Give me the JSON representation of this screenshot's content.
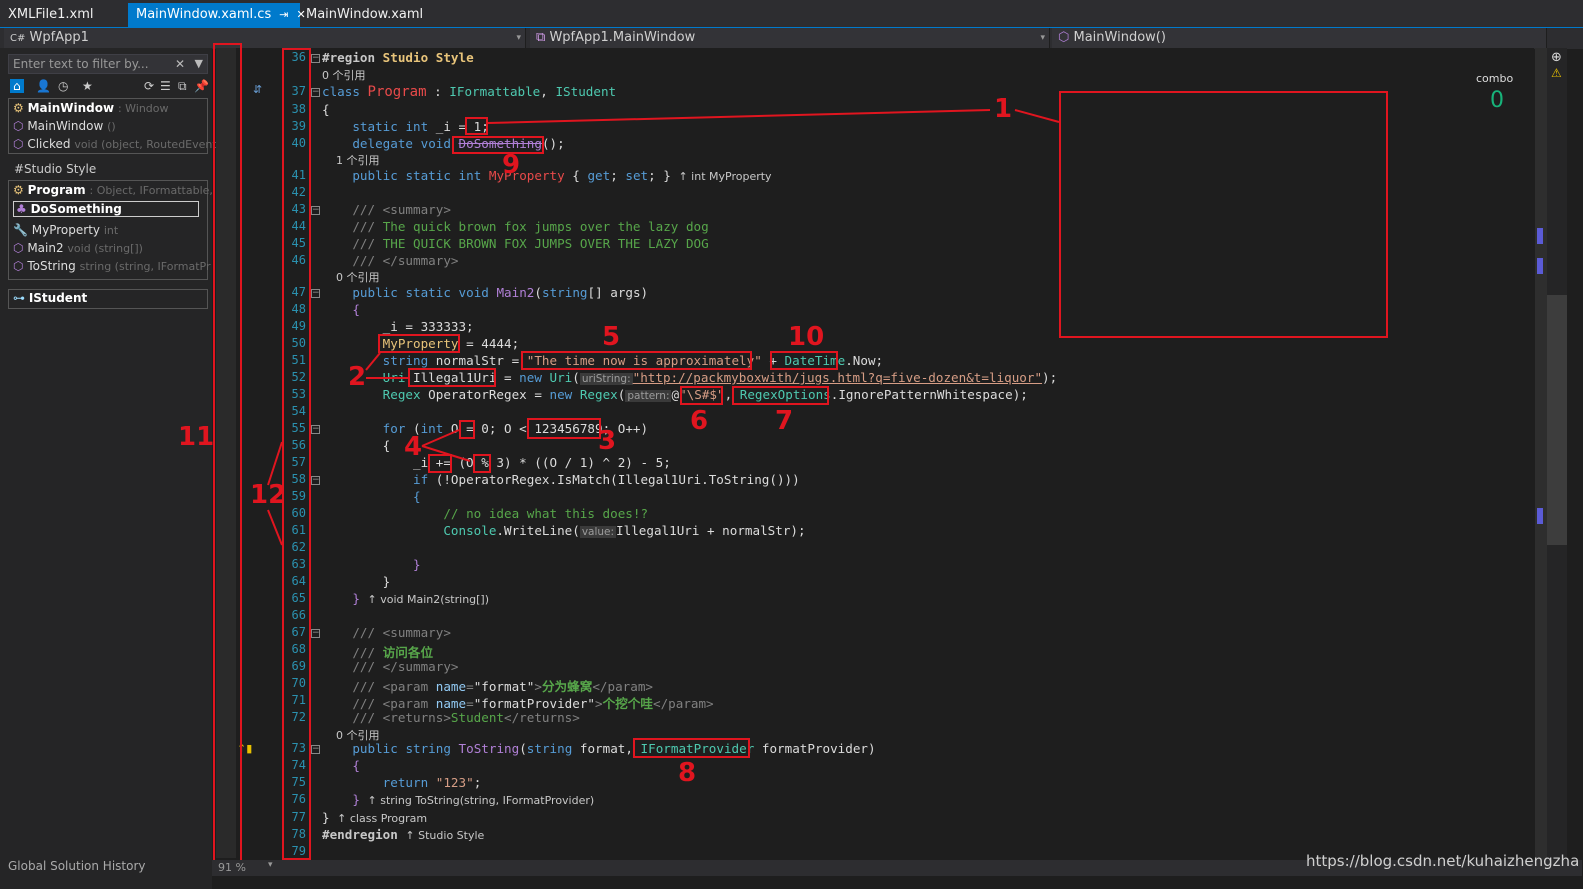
{
  "tabs": [
    {
      "label": "XMLFile1.xml"
    },
    {
      "label": "MainWindow.xaml.cs",
      "active": true
    },
    {
      "label": "MainWindow.xaml"
    }
  ],
  "tab_icons": {
    "pin": "⇥",
    "close": "✕"
  },
  "nav": {
    "project": "WpfApp1",
    "type": "WpfApp1.MainWindow",
    "member": "MainWindow()"
  },
  "sidebar": {
    "filter_placeholder": "Enter text to filter by...",
    "section1": {
      "items": [
        {
          "name": "MainWindow",
          "meta": ": Window"
        },
        {
          "name": "MainWindow",
          "meta": "()"
        },
        {
          "name": "Clicked",
          "meta": "void (object, RoutedEventA"
        }
      ]
    },
    "section2_title": "#Studio Style",
    "section2": {
      "items": [
        {
          "name": "Program",
          "meta": ": Object, IFormattable,"
        },
        {
          "name": "DoSomething",
          "meta": ""
        },
        {
          "name": "MyProperty",
          "meta": "int"
        },
        {
          "name": "Main2",
          "meta": "void (string[])"
        },
        {
          "name": "ToString",
          "meta": "string (string, IFormatPr"
        }
      ]
    },
    "section3_item": "IStudent",
    "footer": "Global Solution History"
  },
  "code": {
    "refs_cn": "个引用",
    "lines": [
      {
        "n": "36"
      },
      {
        "n": "37"
      },
      {
        "n": "38"
      },
      {
        "n": "39"
      },
      {
        "n": "40"
      },
      {
        "n": "41"
      },
      {
        "n": "42"
      },
      {
        "n": "43"
      },
      {
        "n": "44"
      },
      {
        "n": "45"
      },
      {
        "n": "46"
      },
      {
        "n": "47"
      },
      {
        "n": "48"
      },
      {
        "n": "49"
      },
      {
        "n": "50"
      },
      {
        "n": "51"
      },
      {
        "n": "52"
      },
      {
        "n": "53"
      },
      {
        "n": "54"
      },
      {
        "n": "55"
      },
      {
        "n": "56"
      },
      {
        "n": "57"
      },
      {
        "n": "58"
      },
      {
        "n": "59"
      },
      {
        "n": "60"
      },
      {
        "n": "61"
      },
      {
        "n": "62"
      },
      {
        "n": "63"
      },
      {
        "n": "64"
      },
      {
        "n": "65"
      },
      {
        "n": "66"
      },
      {
        "n": "67"
      },
      {
        "n": "68"
      },
      {
        "n": "69"
      },
      {
        "n": "70"
      },
      {
        "n": "71"
      },
      {
        "n": "72"
      },
      {
        "n": "73"
      },
      {
        "n": "74"
      },
      {
        "n": "75"
      },
      {
        "n": "76"
      },
      {
        "n": "77"
      },
      {
        "n": "78"
      },
      {
        "n": "79"
      }
    ]
  },
  "annotations": [
    "1",
    "2",
    "3",
    "4",
    "5",
    "6",
    "7",
    "8",
    "9",
    "10",
    "11",
    "12"
  ],
  "right": {
    "combo_label": "combo",
    "combo_value": "0"
  },
  "zoom": "91 %",
  "watermark": "https://blog.csdn.net/kuhaizhengzha"
}
